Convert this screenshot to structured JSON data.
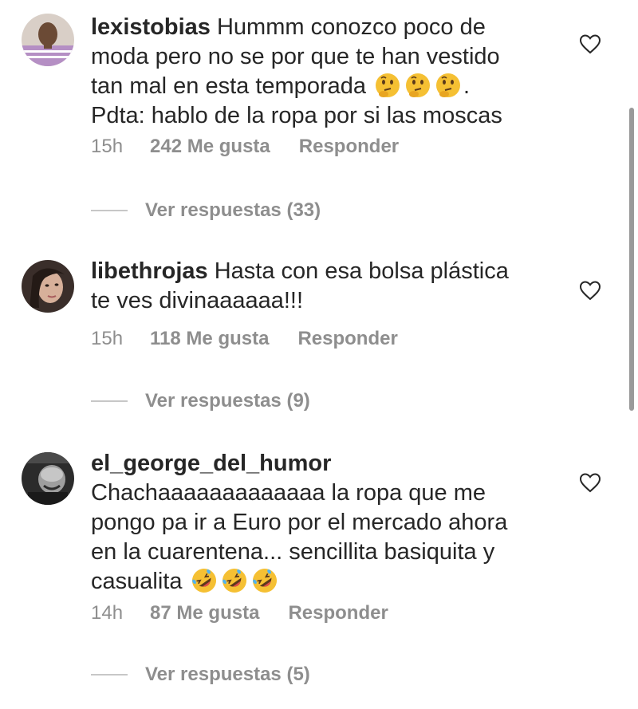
{
  "comments": [
    {
      "username": "lexistobias",
      "text_lines": [
        "Hummm conozco poco de",
        "moda pero no se por que te han vestido",
        "tan mal en esta temporada",
        "Pdta: hablo de la ropa por si las moscas"
      ],
      "emoji_suffix": ".",
      "emojis": [
        "thinking-face",
        "thinking-face",
        "thinking-face"
      ],
      "time": "15h",
      "likes": "242 Me gusta",
      "reply": "Responder",
      "view_replies": "Ver respuestas (33)"
    },
    {
      "username": "libethrojas",
      "text_lines": [
        "Hasta con esa bolsa plástica",
        "te ves divinaaaaaa!!!"
      ],
      "time": "15h",
      "likes": "118 Me gusta",
      "reply": "Responder",
      "view_replies": "Ver respuestas (9)"
    },
    {
      "username": "el_george_del_humor",
      "text_lines": [
        "Chachaaaaaaaaaaaaa la ropa que me",
        "pongo pa ir a Euro por el mercado ahora",
        "en la cuarentena... sencillita basiquita y",
        "casualita"
      ],
      "emojis": [
        "rolling-on-floor-laughing",
        "rolling-on-floor-laughing",
        "rolling-on-floor-laughing"
      ],
      "time": "14h",
      "likes": "87 Me gusta",
      "reply": "Responder",
      "view_replies": "Ver respuestas (5)"
    }
  ],
  "colors": {
    "text": "#262626",
    "meta": "#8e8e8e",
    "emoji_yellow": "#f5c033"
  },
  "icons": [
    "heart-outline-icon",
    "thinking-face-emoji",
    "rolling-on-floor-laughing-emoji"
  ]
}
